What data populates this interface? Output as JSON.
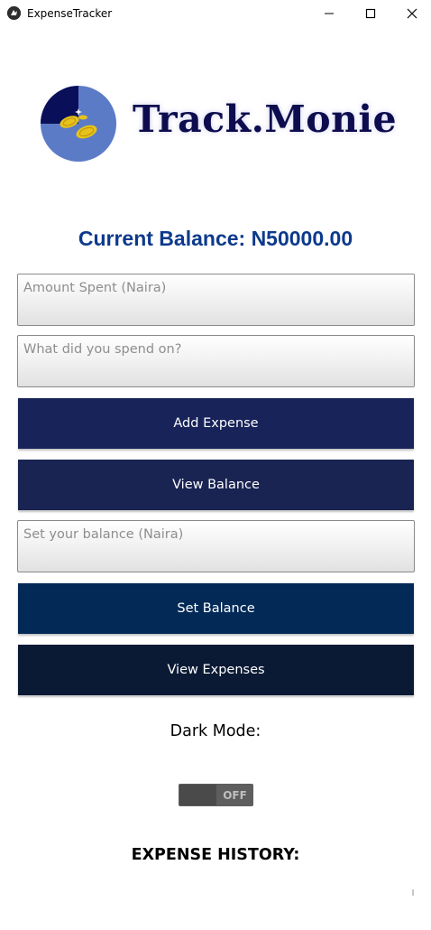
{
  "window": {
    "title": "ExpenseTracker",
    "icons": {
      "app": "kivy-icon",
      "minimize": "minimize-icon",
      "maximize": "maximize-icon",
      "close": "close-icon"
    }
  },
  "logo": {
    "text": "Track.Monie",
    "icon": "pie-chart-coins-icon",
    "colors": {
      "pie_light": "#5b7bc6",
      "pie_dark": "#0a0f5a",
      "coin": "#e8c21a",
      "text": "#0c0c4e"
    }
  },
  "balance": {
    "text": "Current Balance: N50000.00",
    "color": "#0d3a8c"
  },
  "form": {
    "amount_placeholder": "Amount Spent (Naira)",
    "description_placeholder": "What did you spend on?",
    "set_balance_placeholder": "Set your balance (Naira)"
  },
  "buttons": {
    "add_expense": {
      "label": "Add Expense",
      "color": "#172359"
    },
    "view_balance": {
      "label": "View Balance",
      "color": "#192452"
    },
    "set_balance": {
      "label": "Set Balance",
      "color": "#032a57"
    },
    "view_expenses": {
      "label": "View Expenses",
      "color": "#0a1a35"
    }
  },
  "dark_mode": {
    "label": "Dark Mode:",
    "state_text": "OFF",
    "enabled": false
  },
  "history": {
    "label": "EXPENSE HISTORY:"
  }
}
